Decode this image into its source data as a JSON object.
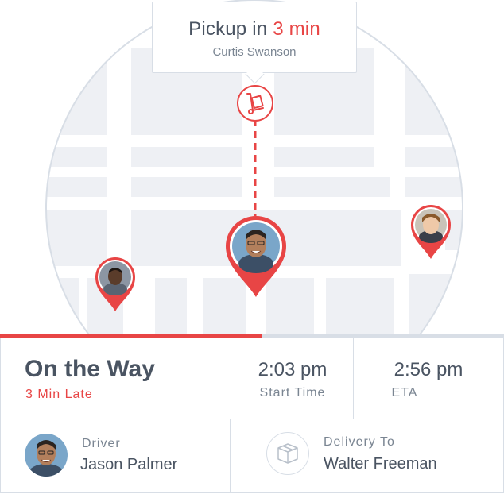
{
  "tooltip": {
    "title_prefix": "Pickup in",
    "title_highlight": "3 min",
    "subtitle": "Curtis Swanson"
  },
  "icons": {
    "pickup": "hand-truck-icon",
    "delivery": "package-box-icon"
  },
  "map": {
    "pins": [
      {
        "name": "driver-location-pin",
        "person": "Jason Palmer"
      },
      {
        "name": "pickup-person-pin-left"
      },
      {
        "name": "pickup-person-pin-right"
      }
    ]
  },
  "progress": {
    "fraction": 0.52
  },
  "status": {
    "title": "On the Way",
    "late": "3 Min Late"
  },
  "times": {
    "start_value": "2:03 pm",
    "start_label": "Start Time",
    "eta_value": "2:56 pm",
    "eta_label": "ETA"
  },
  "driver": {
    "label": "Driver",
    "name": "Jason Palmer"
  },
  "delivery": {
    "label": "Delivery To",
    "name": "Walter Freeman"
  },
  "colors": {
    "accent": "#e84545",
    "text": "#4a5462",
    "muted": "#7a8592",
    "border": "#d8dee6",
    "map_block": "#eef0f4"
  }
}
